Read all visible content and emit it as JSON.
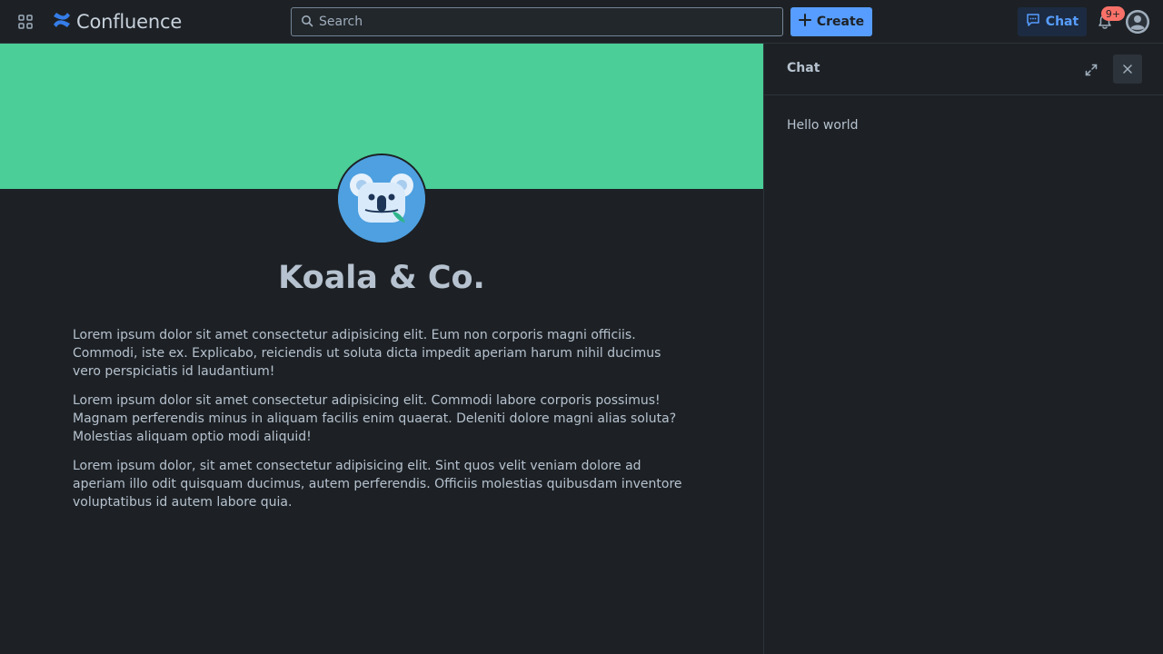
{
  "topbar": {
    "app_switcher_icon": "app-grid-icon",
    "logo_text": "Confluence",
    "logo_icon": "confluence-logo-icon",
    "search_placeholder": "Search",
    "create_label": "Create",
    "chat_label": "Chat",
    "notification_badge": "9+"
  },
  "colors": {
    "banner": "#4bce97",
    "accent": "#579dff",
    "badge": "#f87168",
    "background": "#1d2125"
  },
  "main": {
    "space_title": "Koala & Co.",
    "paragraphs": [
      "Lorem ipsum dolor sit amet consectetur adipisicing elit. Eum non corporis magni officiis. Commodi, iste ex. Explicabo, reiciendis ut soluta dicta impedit aperiam harum nihil ducimus vero perspiciatis id laudantium!",
      "Lorem ipsum dolor sit amet consectetur adipisicing elit. Commodi labore corporis possimus! Magnam perferendis minus in aliquam facilis enim quaerat. Deleniti dolore magni alias soluta? Molestias aliquam optio modi aliquid!",
      "Lorem ipsum dolor, sit amet consectetur adipisicing elit. Sint quos velit veniam dolore ad aperiam illo odit quisquam ducimus, autem perferendis. Officiis molestias quibusdam inventore voluptatibus id autem labore quia."
    ]
  },
  "chat_panel": {
    "title": "Chat",
    "messages": [
      "Hello world"
    ]
  }
}
